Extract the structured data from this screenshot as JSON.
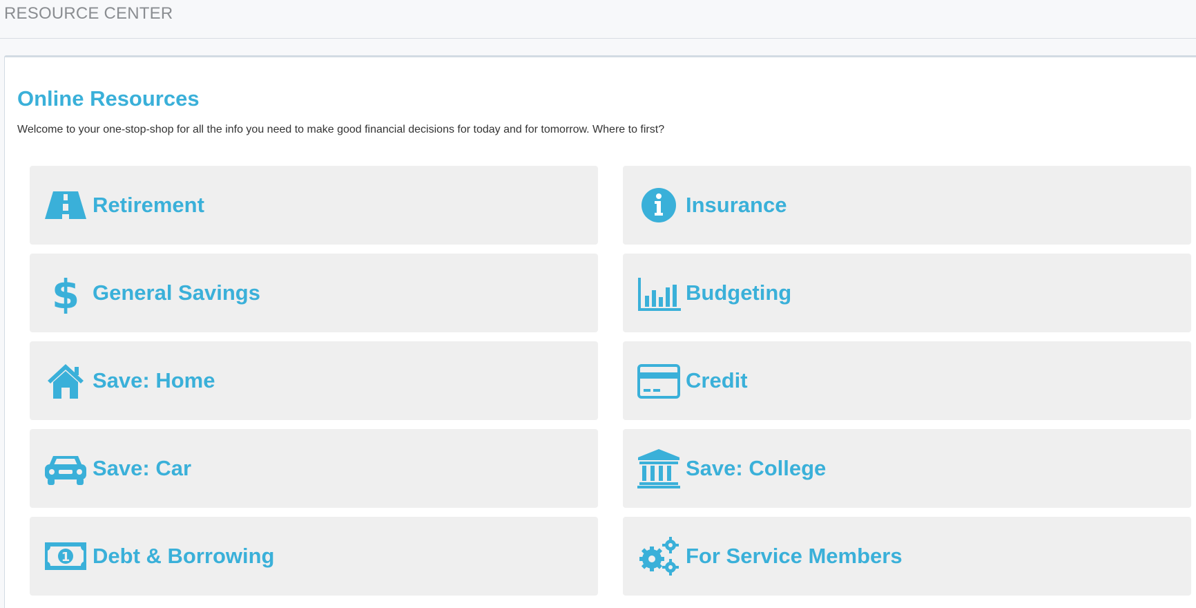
{
  "header": {
    "title": "RESOURCE CENTER"
  },
  "main": {
    "title": "Online Resources",
    "intro": "Welcome to your one-stop-shop for all the info you need to make good financial decisions for today and for tomorrow. Where to first?"
  },
  "colors": {
    "accent": "#3ab0d9",
    "card_bg": "#efefef"
  },
  "cards": [
    {
      "label": "Retirement",
      "icon": "road-icon"
    },
    {
      "label": "Insurance",
      "icon": "info-circle-icon"
    },
    {
      "label": "General Savings",
      "icon": "dollar-icon"
    },
    {
      "label": "Budgeting",
      "icon": "bar-chart-icon"
    },
    {
      "label": "Save: Home",
      "icon": "home-icon"
    },
    {
      "label": "Credit",
      "icon": "credit-card-icon"
    },
    {
      "label": "Save: Car",
      "icon": "car-icon"
    },
    {
      "label": "Save: College",
      "icon": "institution-icon"
    },
    {
      "label": "Debt & Borrowing",
      "icon": "money-icon"
    },
    {
      "label": "For Service Members",
      "icon": "gears-icon"
    }
  ]
}
